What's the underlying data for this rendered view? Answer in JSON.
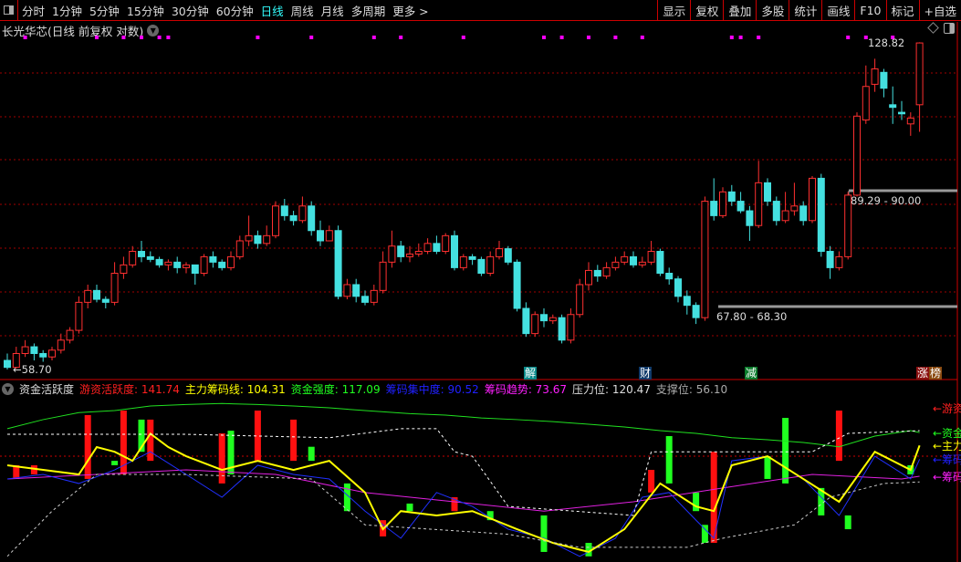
{
  "toolbar": {
    "periods": [
      "分时",
      "1分钟",
      "5分钟",
      "15分钟",
      "30分钟",
      "60分钟",
      "日线",
      "周线",
      "月线",
      "多周期",
      "更多 >"
    ],
    "active": "日线",
    "buttons": [
      "显示",
      "复权",
      "叠加",
      "多股",
      "统计",
      "画线",
      "F10",
      "标记",
      "+自选"
    ]
  },
  "title": "长光华芯(日线 前复权 对数)",
  "price_labels": {
    "high": "128.82",
    "low": "58.70",
    "zone_upper": "89.29 - 90.00",
    "zone_lower": "67.80 - 68.30"
  },
  "events": [
    {
      "text": "解",
      "color": "#0a8a8a"
    },
    {
      "text": "财",
      "color": "#103a6a"
    },
    {
      "text": "减",
      "color": "#0a7a2a"
    },
    {
      "text": "涨",
      "color": "#8a1010"
    },
    {
      "text": "榜",
      "color": "#8a4a10"
    }
  ],
  "indicator": {
    "name": "资金活跃度",
    "items": [
      {
        "label": "游资活跃度:",
        "value": "141.74",
        "color": "#ff2020"
      },
      {
        "label": "主力筹码线:",
        "value": "104.31",
        "color": "#ffff00"
      },
      {
        "label": "资金强度:",
        "value": "117.09",
        "color": "#20ff20"
      },
      {
        "label": "筹码集中度:",
        "value": "90.52",
        "color": "#2020ff"
      },
      {
        "label": "筹码趋势:",
        "value": "73.67",
        "color": "#ff20ff"
      },
      {
        "label": "压力位:",
        "value": "120.47",
        "color": "#dddddd"
      },
      {
        "label": "支撑位:",
        "value": "56.10",
        "color": "#aaaaaa"
      }
    ],
    "right_labels": [
      {
        "text": "游资活跃度",
        "color": "#ff2020",
        "value": 141.74
      },
      {
        "text": "资金强度",
        "color": "#20ff20",
        "value": 117.09
      },
      {
        "text": "主力筹码线",
        "color": "#ffff00",
        "value": 104.31
      },
      {
        "text": "筹码集中度",
        "color": "#2020ff",
        "value": 90.52
      },
      {
        "text": "筹码趋势",
        "color": "#ff20ff",
        "value": 73.67
      }
    ]
  },
  "chart_data": {
    "type": "candlestick",
    "price_scale": "log",
    "price_range": [
      58.7,
      128.82
    ],
    "colors": {
      "up": "#ff3030",
      "down": "#44e0e0",
      "grid": "#a00000"
    },
    "ohlc": [
      [
        60,
        59,
        61,
        58.7
      ],
      [
        59,
        61,
        62,
        58.8
      ],
      [
        61,
        62,
        63,
        60.5
      ],
      [
        62,
        61,
        62.5,
        60
      ],
      [
        61,
        60.5,
        61.5,
        59.8
      ],
      [
        60.5,
        61.5,
        62,
        60
      ],
      [
        61.5,
        63,
        64,
        61
      ],
      [
        63,
        64.5,
        65,
        62.5
      ],
      [
        64.5,
        69,
        70,
        64
      ],
      [
        69,
        71,
        72,
        68
      ],
      [
        71,
        69.5,
        72,
        69
      ],
      [
        69.5,
        69,
        70,
        68
      ],
      [
        69,
        74,
        76,
        68.5
      ],
      [
        74,
        75.5,
        77,
        73
      ],
      [
        75.5,
        78,
        79,
        75
      ],
      [
        78,
        77,
        80,
        76
      ],
      [
        77,
        76.5,
        78,
        76
      ],
      [
        76.5,
        75.5,
        77,
        75
      ],
      [
        75.5,
        76,
        76.5,
        74.5
      ],
      [
        76,
        75,
        77,
        74
      ],
      [
        75,
        75.5,
        76,
        74
      ],
      [
        75.5,
        74,
        75.5,
        72
      ],
      [
        74,
        77,
        77.5,
        73.5
      ],
      [
        77,
        76,
        78,
        75
      ],
      [
        76,
        75,
        76.5,
        74.5
      ],
      [
        75,
        77,
        78,
        74.5
      ],
      [
        77,
        80,
        81,
        76.5
      ],
      [
        80,
        81,
        85,
        79
      ],
      [
        81,
        79.5,
        82,
        78.5
      ],
      [
        79.5,
        81,
        83,
        79
      ],
      [
        81,
        87,
        88,
        80.5
      ],
      [
        87,
        85,
        88.5,
        84
      ],
      [
        85,
        84,
        86,
        83
      ],
      [
        84,
        87,
        89,
        83.5
      ],
      [
        87,
        82,
        88,
        81
      ],
      [
        82,
        80,
        84,
        79
      ],
      [
        80,
        82,
        83,
        80
      ],
      [
        82,
        70,
        83,
        69.5
      ],
      [
        70,
        72,
        73,
        69.5
      ],
      [
        72,
        70,
        73,
        69
      ],
      [
        70,
        69,
        71,
        68.5
      ],
      [
        69,
        71,
        72,
        68.5
      ],
      [
        71,
        76,
        78,
        70.5
      ],
      [
        76,
        79,
        82,
        75
      ],
      [
        79,
        77,
        80,
        76
      ],
      [
        77,
        77.5,
        79,
        76
      ],
      [
        77.5,
        78,
        79.5,
        77
      ],
      [
        78,
        79.5,
        80.5,
        77.5
      ],
      [
        79.5,
        78,
        81,
        77.5
      ],
      [
        78,
        81,
        81.5,
        77.5
      ],
      [
        81,
        75,
        82,
        74.5
      ],
      [
        75,
        77,
        77.5,
        74.5
      ],
      [
        77,
        76.5,
        77.5,
        75.5
      ],
      [
        76.5,
        74,
        77,
        73.5
      ],
      [
        74,
        77,
        78,
        73.5
      ],
      [
        77,
        78.5,
        80,
        76.5
      ],
      [
        78.5,
        76,
        79,
        75.5
      ],
      [
        76,
        68,
        76.5,
        67.5
      ],
      [
        68,
        64,
        69,
        63.5
      ],
      [
        64,
        67,
        67.5,
        63.5
      ],
      [
        67,
        66,
        68,
        65
      ],
      [
        66,
        66.5,
        67,
        65.5
      ],
      [
        66.5,
        63,
        67,
        62.5
      ],
      [
        63,
        67,
        68,
        62.5
      ],
      [
        67,
        72,
        73,
        66.5
      ],
      [
        72,
        74.5,
        76,
        71
      ],
      [
        74.5,
        73.5,
        75.5,
        72.5
      ],
      [
        73.5,
        75,
        76,
        73
      ],
      [
        75,
        76,
        77,
        74.5
      ],
      [
        76,
        77,
        78,
        75.5
      ],
      [
        77,
        75.5,
        78,
        75
      ],
      [
        75.5,
        76,
        77,
        75
      ],
      [
        76,
        78,
        80,
        75.5
      ],
      [
        78,
        74,
        78.5,
        73.5
      ],
      [
        74,
        73,
        75,
        72
      ],
      [
        73,
        70,
        73.5,
        69
      ],
      [
        70,
        68.5,
        71,
        67
      ],
      [
        68.5,
        66.5,
        69,
        65.5
      ],
      [
        66.5,
        88,
        89,
        66
      ],
      [
        88,
        85,
        93,
        84
      ],
      [
        85,
        90,
        91,
        84.5
      ],
      [
        90,
        88,
        91.5,
        87
      ],
      [
        88,
        86,
        90,
        85.5
      ],
      [
        86,
        83,
        87,
        80
      ],
      [
        83,
        92,
        97,
        82.5
      ],
      [
        92,
        88,
        93,
        87
      ],
      [
        88,
        84,
        89,
        83
      ],
      [
        84,
        86,
        90,
        83.5
      ],
      [
        86,
        87,
        92,
        85
      ],
      [
        87,
        84,
        88,
        83
      ],
      [
        84,
        93,
        93.5,
        83.5
      ],
      [
        93,
        78,
        94,
        77
      ],
      [
        78,
        75,
        79,
        73
      ],
      [
        75,
        77,
        78,
        74.5
      ],
      [
        77,
        89.3,
        90,
        76.5
      ],
      [
        89.3,
        108,
        109,
        89
      ],
      [
        107,
        116,
        122,
        106
      ],
      [
        116.6,
        121,
        124,
        114.5
      ],
      [
        120,
        115.5,
        121,
        113
      ],
      [
        111,
        110.3,
        116,
        106
      ],
      [
        109,
        108.6,
        112,
        107
      ],
      [
        106,
        107.5,
        109,
        103
      ],
      [
        111,
        128.8,
        129,
        104
      ]
    ],
    "marker_bars": [
      2,
      10,
      13,
      15,
      17,
      18,
      28,
      34,
      41,
      44,
      51,
      60,
      62,
      65,
      68,
      71,
      81,
      82,
      84,
      94,
      96,
      99
    ],
    "indicator_range": [
      -12,
      152
    ],
    "series": [
      {
        "name": "资金强度",
        "color": "#20e020",
        "points": [
          [
            0,
            121
          ],
          [
            4,
            130
          ],
          [
            8,
            137
          ],
          [
            12,
            139
          ],
          [
            16,
            143.5
          ],
          [
            20,
            145
          ],
          [
            24,
            146
          ],
          [
            28,
            145
          ],
          [
            32,
            143.5
          ],
          [
            36,
            141.7
          ],
          [
            40,
            139
          ],
          [
            45,
            136
          ],
          [
            49,
            134.5
          ],
          [
            53,
            131.7
          ],
          [
            57,
            130
          ],
          [
            61,
            128
          ],
          [
            65,
            125.4
          ],
          [
            69,
            122.7
          ],
          [
            73,
            119
          ],
          [
            77,
            116.3
          ],
          [
            81,
            112
          ],
          [
            85,
            110
          ],
          [
            89,
            107.3
          ],
          [
            93,
            103
          ],
          [
            97,
            113.6
          ],
          [
            101,
            119
          ],
          [
            102,
            117.1
          ]
        ]
      },
      {
        "name": "筹码趋势",
        "color": "#e020e0",
        "points": [
          [
            0,
            71
          ],
          [
            10,
            75.5
          ],
          [
            20,
            80
          ],
          [
            30,
            75.5
          ],
          [
            40,
            57.5
          ],
          [
            50,
            48.3
          ],
          [
            60,
            39
          ],
          [
            70,
            48.3
          ],
          [
            80,
            62
          ],
          [
            90,
            75.5
          ],
          [
            100,
            71
          ],
          [
            102,
            73.7
          ]
        ]
      },
      {
        "name": "筹码集中度",
        "color": "#2030ff",
        "points": [
          [
            0,
            71
          ],
          [
            4,
            75.5
          ],
          [
            8,
            66.5
          ],
          [
            12,
            80
          ],
          [
            16,
            98
          ],
          [
            20,
            75.5
          ],
          [
            24,
            52.8
          ],
          [
            28,
            84.6
          ],
          [
            32,
            75.5
          ],
          [
            36,
            71
          ],
          [
            40,
            39
          ],
          [
            44,
            12
          ],
          [
            48,
            57.5
          ],
          [
            52,
            43.7
          ],
          [
            56,
            21
          ],
          [
            60,
            12
          ],
          [
            64,
            -6
          ],
          [
            68,
            12
          ],
          [
            71,
            52.8
          ],
          [
            74,
            57.5
          ],
          [
            77,
            30
          ],
          [
            79,
            12
          ],
          [
            81,
            89
          ],
          [
            85,
            93.6
          ],
          [
            89,
            71
          ],
          [
            93,
            34.7
          ],
          [
            97,
            93.6
          ],
          [
            101,
            71
          ],
          [
            102,
            90.5
          ]
        ]
      },
      {
        "name": "主力筹码线",
        "color": "#ffff00",
        "points": [
          [
            0,
            84.6
          ],
          [
            4,
            80
          ],
          [
            8,
            75.5
          ],
          [
            10,
            102.7
          ],
          [
            12,
            98
          ],
          [
            14,
            89
          ],
          [
            16,
            116
          ],
          [
            18,
            102.7
          ],
          [
            20,
            93.6
          ],
          [
            24,
            80
          ],
          [
            28,
            89
          ],
          [
            32,
            80
          ],
          [
            36,
            89
          ],
          [
            40,
            57.5
          ],
          [
            42,
            21
          ],
          [
            44,
            39
          ],
          [
            48,
            34.7
          ],
          [
            52,
            39
          ],
          [
            57,
            21
          ],
          [
            61,
            7.4
          ],
          [
            65,
            -1.6
          ],
          [
            69,
            21
          ],
          [
            73,
            66.5
          ],
          [
            77,
            43.7
          ],
          [
            79,
            39
          ],
          [
            81,
            84.6
          ],
          [
            85,
            93.6
          ],
          [
            89,
            71
          ],
          [
            93,
            48.3
          ],
          [
            97,
            98
          ],
          [
            101,
            80
          ],
          [
            102,
            104.3
          ]
        ]
      },
      {
        "name": "压力位",
        "color": "#ffffff",
        "dash": true,
        "points": [
          [
            0,
            115.4
          ],
          [
            20,
            115.4
          ],
          [
            36,
            112
          ],
          [
            44,
            121
          ],
          [
            48,
            121
          ],
          [
            50,
            98
          ],
          [
            52,
            93.6
          ],
          [
            56,
            43.7
          ],
          [
            70,
            34.7
          ],
          [
            72,
            98
          ],
          [
            90,
            98
          ],
          [
            94,
            116.3
          ],
          [
            102,
            119
          ]
        ]
      },
      {
        "name": "支撑位",
        "color": "#cccccc",
        "dash": true,
        "points": [
          [
            0,
            -6
          ],
          [
            5,
            39
          ],
          [
            10,
            75.5
          ],
          [
            20,
            75.5
          ],
          [
            34,
            71
          ],
          [
            40,
            25.3
          ],
          [
            56,
            16
          ],
          [
            64,
            3
          ],
          [
            76,
            3
          ],
          [
            80,
            12
          ],
          [
            88,
            25.3
          ],
          [
            92,
            52.8
          ],
          [
            98,
            66.5
          ],
          [
            102,
            68
          ]
        ]
      }
    ],
    "bars": [
      [
        1,
        84.6,
        71,
        "red"
      ],
      [
        3,
        84.6,
        75.5,
        "red"
      ],
      [
        9,
        134.5,
        71,
        "red"
      ],
      [
        12,
        89,
        84.6,
        "green"
      ],
      [
        13,
        139,
        75.5,
        "red"
      ],
      [
        15,
        130,
        98,
        "green"
      ],
      [
        16,
        130,
        89,
        "red"
      ],
      [
        24,
        116.3,
        66.5,
        "red"
      ],
      [
        25,
        119,
        75.5,
        "green"
      ],
      [
        28,
        139,
        89,
        "red"
      ],
      [
        32,
        130,
        89,
        "red"
      ],
      [
        34,
        103,
        89,
        "green"
      ],
      [
        38,
        66.5,
        39,
        "green"
      ],
      [
        42,
        30,
        13.8,
        "red"
      ],
      [
        45,
        46.5,
        39,
        "green"
      ],
      [
        50,
        52.8,
        39,
        "red"
      ],
      [
        54,
        39,
        30,
        "green"
      ],
      [
        60,
        34.7,
        -1.6,
        "green"
      ],
      [
        65,
        7.4,
        -6,
        "green"
      ],
      [
        72,
        80,
        57.5,
        "red"
      ],
      [
        74,
        113.6,
        66.5,
        "green"
      ],
      [
        77,
        57.5,
        39,
        "green"
      ],
      [
        78,
        25.3,
        7.4,
        "green"
      ],
      [
        79,
        98,
        7.4,
        "red"
      ],
      [
        85,
        93.6,
        71,
        "green"
      ],
      [
        87,
        131.7,
        66.5,
        "green"
      ],
      [
        91,
        62,
        34.7,
        "green"
      ],
      [
        93,
        139,
        89,
        "red"
      ],
      [
        94,
        34.7,
        21,
        "green"
      ],
      [
        101,
        84.6,
        75.5,
        "green"
      ]
    ]
  }
}
